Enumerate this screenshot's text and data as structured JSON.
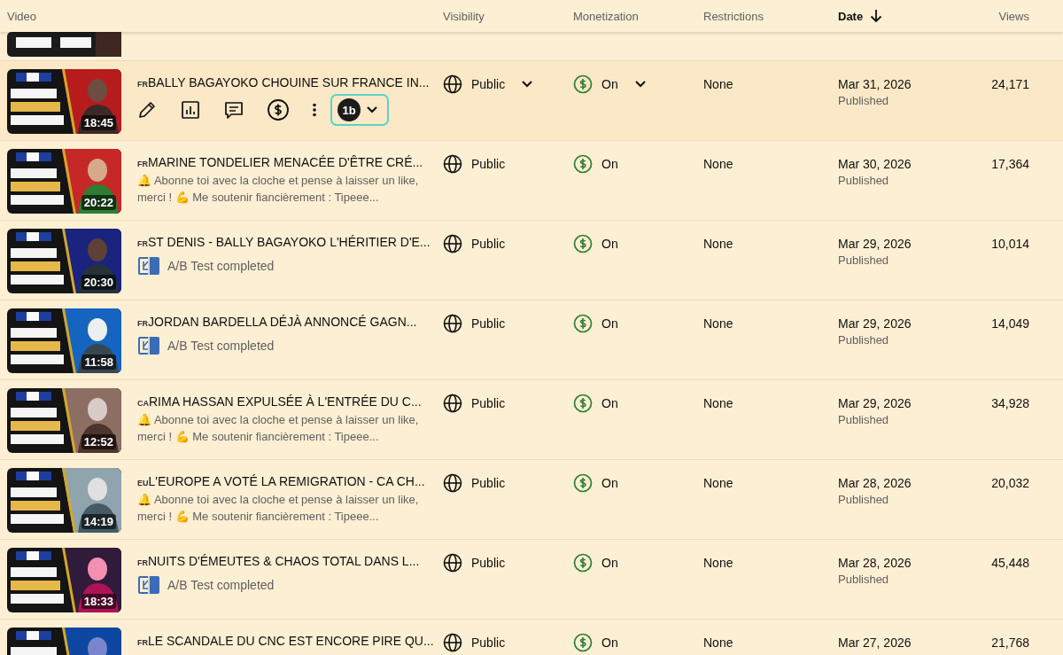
{
  "columns": [
    {
      "label": "Video",
      "sorted": false
    },
    {
      "label": "Visibility",
      "sorted": false
    },
    {
      "label": "Monetization",
      "sorted": false
    },
    {
      "label": "Restrictions",
      "sorted": false
    },
    {
      "label": "Date",
      "sorted": true
    },
    {
      "label": "Views",
      "sorted": false
    }
  ],
  "extension": {
    "label": "1b"
  },
  "rows": [
    {
      "country": "FR",
      "title": "BALLY BAGAYOKO CHOUINE SUR FRANCE IN...",
      "duration": "18:45",
      "hovered": true,
      "secondary": {
        "kind": "actions"
      },
      "visibility": "Public",
      "monetization": "On",
      "restrictions": "None",
      "date": "Mar 31, 2026",
      "status": "Published",
      "views": "24,171"
    },
    {
      "country": "FR",
      "title": "MARINE TONDELIER MENACÉE D'ÊTRE CRÉ...",
      "duration": "20:22",
      "hovered": false,
      "secondary": {
        "kind": "description",
        "text": "🔔 Abonne toi avec la cloche et pense à laisser un like, merci ! 💪 Me soutenir fiancièrement : Tipeee..."
      },
      "visibility": "Public",
      "monetization": "On",
      "restrictions": "None",
      "date": "Mar 30, 2026",
      "status": "Published",
      "views": "17,364"
    },
    {
      "country": "FR",
      "title": "ST DENIS - BALLY BAGAYOKO L'HÉRITIER D'E...",
      "duration": "20:30",
      "hovered": false,
      "secondary": {
        "kind": "ab_test",
        "text": "A/B Test completed"
      },
      "visibility": "Public",
      "monetization": "On",
      "restrictions": "None",
      "date": "Mar 29, 2026",
      "status": "Published",
      "views": "10,014"
    },
    {
      "country": "FR",
      "title": "JORDAN BARDELLA DÉJÀ ANNONCÉ GAGN...",
      "duration": "11:58",
      "hovered": false,
      "secondary": {
        "kind": "ab_test",
        "text": "A/B Test completed"
      },
      "visibility": "Public",
      "monetization": "On",
      "restrictions": "None",
      "date": "Mar 29, 2026",
      "status": "Published",
      "views": "14,049"
    },
    {
      "country": "CA",
      "title": "RIMA HASSAN EXPULSÉE À L'ENTRÉE DU C...",
      "duration": "12:52",
      "hovered": false,
      "secondary": {
        "kind": "description",
        "text": "🔔 Abonne toi avec la cloche et pense à laisser un like, merci ! 💪 Me soutenir fiancièrement : Tipeee..."
      },
      "visibility": "Public",
      "monetization": "On",
      "restrictions": "None",
      "date": "Mar 29, 2026",
      "status": "Published",
      "views": "34,928"
    },
    {
      "country": "EU",
      "title": "L'EUROPE A VOTÉ LA REMIGRATION - CA CH...",
      "duration": "14:19",
      "hovered": false,
      "secondary": {
        "kind": "description",
        "text": "🔔 Abonne toi avec la cloche et pense à laisser un like, merci ! 💪 Me soutenir fiancièrement : Tipeee..."
      },
      "visibility": "Public",
      "monetization": "On",
      "restrictions": "None",
      "date": "Mar 28, 2026",
      "status": "Published",
      "views": "20,032"
    },
    {
      "country": "FR",
      "title": "NUITS D'ÉMEUTES & CHAOS TOTAL DANS L...",
      "duration": "18:33",
      "hovered": false,
      "secondary": {
        "kind": "ab_test",
        "text": "A/B Test completed"
      },
      "visibility": "Public",
      "monetization": "On",
      "restrictions": "None",
      "date": "Mar 28, 2026",
      "status": "Published",
      "views": "45,448"
    },
    {
      "country": "FR",
      "title": "LE SCANDALE DU CNC EST ENCORE PIRE QU...",
      "hovered": false,
      "visibility": "Public",
      "monetization": "On",
      "restrictions": "None",
      "date": "Mar 27, 2026",
      "views": "21,768"
    }
  ]
}
